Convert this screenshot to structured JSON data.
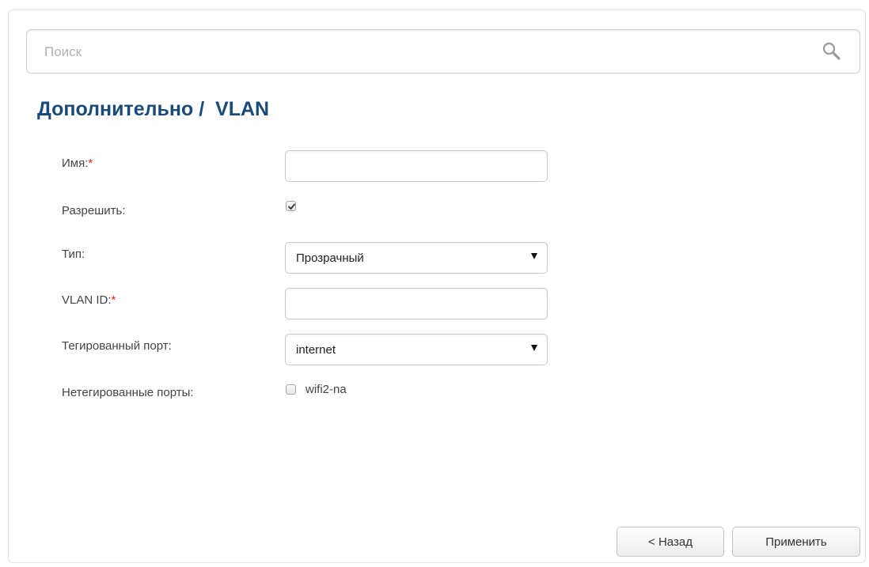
{
  "search": {
    "placeholder": "Поиск",
    "icon": "search-icon"
  },
  "page": {
    "title": "Дополнительно /  VLAN"
  },
  "form": {
    "name": {
      "label": "Имя:",
      "required_mark": "*",
      "value": ""
    },
    "enable": {
      "label": "Разрешить:",
      "checked": true
    },
    "type": {
      "label": "Тип:",
      "selected": "Прозрачный"
    },
    "vlan_id": {
      "label": "VLAN ID:",
      "required_mark": "*",
      "value": ""
    },
    "tagged_port": {
      "label": "Тегированный порт:",
      "selected": "internet"
    },
    "untagged_ports": {
      "label": "Нетегированные порты:",
      "options": [
        {
          "label": "wifi2-na",
          "checked": false
        }
      ]
    }
  },
  "buttons": {
    "back": "< Назад",
    "apply": "Применить"
  },
  "colors": {
    "title": "#1a4b78",
    "required": "#e1251b",
    "label": "#444444"
  }
}
